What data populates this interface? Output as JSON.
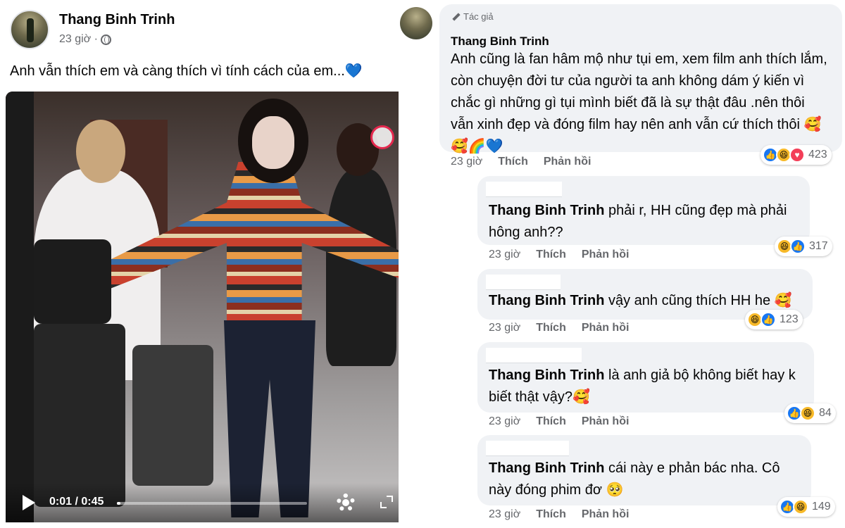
{
  "post": {
    "author": "Thang Binh Trinh",
    "time": "23 giờ ·",
    "text": "Anh vẫn thích em và càng thích vì tính cách của em...💙",
    "video": {
      "time_display": "0:01 / 0:45",
      "progress": 0.02
    }
  },
  "comments": {
    "main": {
      "badge": "Tác giả",
      "author": "Thang Binh Trinh",
      "text": "Anh cũng là fan hâm mộ như tụi em, xem film anh thích lắm, còn chuyện đời tư của người ta anh không dám ý kiến vì chắc gì những gì tụi mình biết đã là sự thật đâu .nên thôi vẫn xinh đẹp và đóng film hay nên anh vẫn cứ thích thôi 🥰🥰🌈💙",
      "time": "23 giờ",
      "like": "Thích",
      "reply": "Phản hồi",
      "reaction_count": "423"
    },
    "replies": [
      {
        "mention": "Thang Binh Trinh",
        "text": " phải r, HH cũng đẹp mà phải hông anh??",
        "time": "23 giờ",
        "like": "Thích",
        "reply": "Phản hồi",
        "reaction_count": "317"
      },
      {
        "mention": "Thang Binh Trinh",
        "text": " vậy anh cũng thích HH he 🥰",
        "time": "23 giờ",
        "like": "Thích",
        "reply": "Phản hồi",
        "reaction_count": "123"
      },
      {
        "mention": "Thang Binh Trinh",
        "text": " là anh giả bộ không biết hay k biết thật vậy?🥰",
        "time": "23 giờ",
        "like": "Thích",
        "reply": "Phản hồi",
        "reaction_count": "84"
      },
      {
        "mention": "Thang Binh Trinh",
        "text": " cái này e phản bác nha. Cô này đóng phim đơ 🥺",
        "time": "23 giờ",
        "like": "Thích",
        "reply": "Phản hồi",
        "reaction_count": "149"
      }
    ]
  },
  "icons": {
    "globe": "globe-icon",
    "play": "play-icon",
    "settings": "gear-icon",
    "fullscreen": "fullscreen-icon",
    "pen": "pen-icon"
  },
  "colors": {
    "facebook_blue": "#1877f2",
    "bubble_gray": "#f0f2f5",
    "meta_gray": "#65676b",
    "love_red": "#f33e58",
    "haha_yellow": "#f7b928"
  }
}
